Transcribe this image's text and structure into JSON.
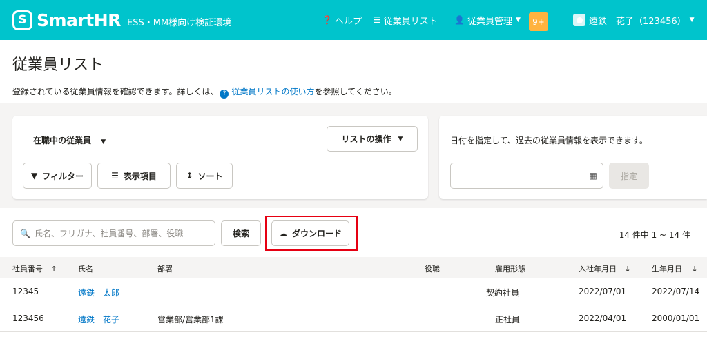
{
  "header": {
    "logo_mark": "S",
    "logo_text": "SmartHR",
    "env_label": "ESS・MM様向け検証環境",
    "help": "ヘルプ",
    "employee_list": "従業員リスト",
    "employee_mgmt": "従業員管理",
    "notif_count": "9+",
    "user_name": "遠鉄　花子（123456）"
  },
  "page": {
    "title": "従業員リスト",
    "desc_before": "登録されている従業員情報を確認できます。詳しくは、",
    "desc_link": "従業員リストの使い方",
    "desc_after": "を参照してください。"
  },
  "filters": {
    "employee_filter": "在職中の従業員",
    "list_ops": "リストの操作",
    "filter_btn": "フィルター",
    "columns_btn": "表示項目",
    "sort_btn": "ソート",
    "date_desc": "日付を指定して、過去の従業員情報を表示できます。",
    "apply_btn": "指定"
  },
  "search": {
    "placeholder": "氏名、フリガナ、社員番号、部署、役職",
    "search_btn": "検索",
    "download_btn": "ダウンロード",
    "result_count": "14 件中 1 ~ 14 件"
  },
  "table": {
    "headers": {
      "emp_no": "社員番号",
      "name": "氏名",
      "dept": "部署",
      "position": "役職",
      "employment": "雇用形態",
      "hire_date": "入社年月日",
      "birth_date": "生年月日"
    },
    "rows": [
      {
        "emp_no": "12345",
        "name": "遠鉄　太郎",
        "dept": "",
        "position": "",
        "employment": "契約社員",
        "hire_date": "2022/07/01",
        "birth_date": "2022/07/14"
      },
      {
        "emp_no": "123456",
        "name": "遠鉄　花子",
        "dept": "営業部/営業部1課",
        "position": "",
        "employment": "正社員",
        "hire_date": "2022/04/01",
        "birth_date": "2000/01/01"
      }
    ]
  },
  "colors": {
    "brand": "#00c4cc",
    "badge": "#ffb33f",
    "link": "#0077c7",
    "highlight": "#e60012"
  }
}
